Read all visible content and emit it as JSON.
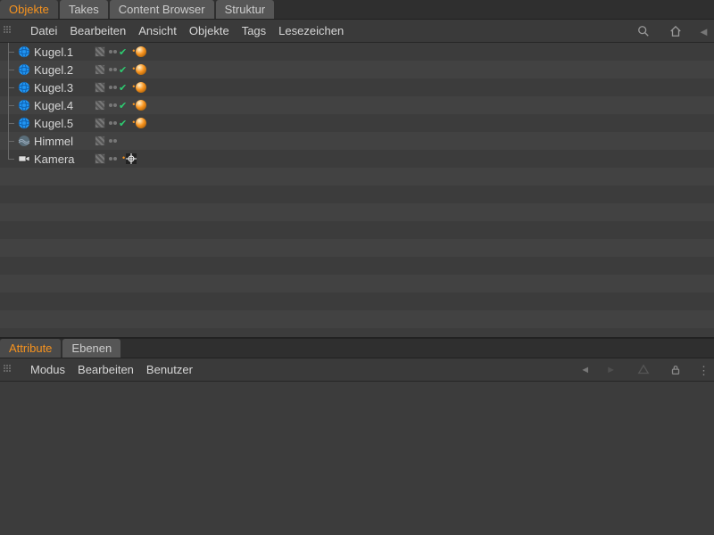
{
  "tabs_top": [
    {
      "label": "Objekte",
      "active": true
    },
    {
      "label": "Takes",
      "active": false
    },
    {
      "label": "Content Browser",
      "active": false
    },
    {
      "label": "Struktur",
      "active": false
    }
  ],
  "menu_top": [
    "Datei",
    "Bearbeiten",
    "Ansicht",
    "Objekte",
    "Tags",
    "Lesezeichen"
  ],
  "objects": [
    {
      "name": "Kugel.1",
      "icon": "sphere",
      "tag": "phong",
      "check": true
    },
    {
      "name": "Kugel.2",
      "icon": "sphere",
      "tag": "phong",
      "check": true
    },
    {
      "name": "Kugel.3",
      "icon": "sphere",
      "tag": "phong",
      "check": true
    },
    {
      "name": "Kugel.4",
      "icon": "sphere",
      "tag": "phong",
      "check": true
    },
    {
      "name": "Kugel.5",
      "icon": "sphere",
      "tag": "phong",
      "check": true
    },
    {
      "name": "Himmel",
      "icon": "sky",
      "tag": null,
      "check": false
    },
    {
      "name": "Kamera",
      "icon": "camera",
      "tag": "target",
      "check": false,
      "last": true
    }
  ],
  "tabs_bottom": [
    {
      "label": "Attribute",
      "active": true
    },
    {
      "label": "Ebenen",
      "active": false
    }
  ],
  "menu_bottom": [
    "Modus",
    "Bearbeiten",
    "Benutzer"
  ]
}
